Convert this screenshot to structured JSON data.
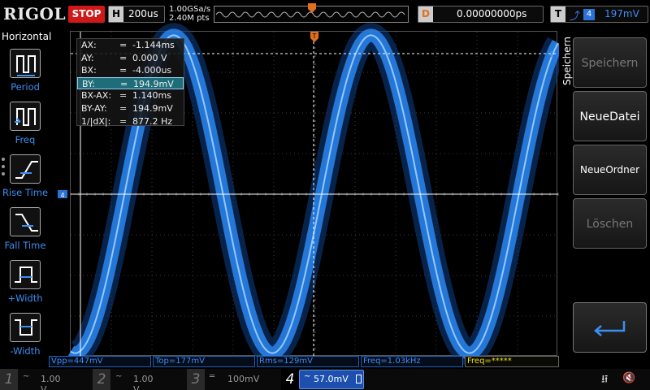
{
  "topbar": {
    "brand": "RIGOL",
    "run_state": "STOP",
    "horizontal": {
      "key": "H",
      "timebase": "200us"
    },
    "sample_rate": "1.00GSa/s",
    "memory_points": "2.40M pts",
    "delay": {
      "key": "D",
      "value": "0.00000000ps"
    },
    "trigger": {
      "key": "T",
      "edge_symbol": "⤴",
      "source": "4",
      "level": "197mV"
    }
  },
  "left_menu": {
    "title": "Horizontal",
    "items": [
      {
        "label": "Period",
        "icon": "period-icon"
      },
      {
        "label": "Freq",
        "icon": "frequency-icon"
      },
      {
        "label": "Rise Time",
        "icon": "rise-time-icon"
      },
      {
        "label": "Fall Time",
        "icon": "fall-time-icon"
      },
      {
        "label": "+Width",
        "icon": "positive-width-icon"
      },
      {
        "label": "-Width",
        "icon": "negative-width-icon"
      }
    ]
  },
  "cursor_readout": {
    "rows": [
      {
        "label": "AX:",
        "eq": "=",
        "value": "-1.144ms"
      },
      {
        "label": "AY:",
        "eq": "=",
        "value": "0.000 V"
      },
      {
        "label": "BX:",
        "eq": "=",
        "value": "-4.000us"
      },
      {
        "label": "BY:",
        "eq": "=",
        "value": "194.9mV"
      },
      {
        "label": "BX-AX:",
        "eq": "=",
        "value": "1.140ms"
      },
      {
        "label": "BY-AY:",
        "eq": "=",
        "value": "194.9mV"
      },
      {
        "label": "1/|dX|:",
        "eq": "=",
        "value": "877.2 Hz"
      }
    ],
    "selected_row": 3
  },
  "right_menu": {
    "title": "Speichern",
    "buttons": [
      {
        "label": "Speichern",
        "enabled": false
      },
      {
        "label": "NeueDatei",
        "enabled": true
      },
      {
        "label": "NeueOrdner",
        "enabled": true
      },
      {
        "label": "Löschen",
        "enabled": false
      }
    ],
    "back_icon": "return-arrow-icon"
  },
  "measurements": [
    {
      "text": "Vpp=447mV",
      "color": "#3f8df0"
    },
    {
      "text": "Top=177mV",
      "color": "#3f8df0"
    },
    {
      "text": "Rms=129mV",
      "color": "#3f8df0"
    },
    {
      "text": "Freq=1.03kHz",
      "color": "#3f8df0"
    },
    {
      "text": "Freq=*****",
      "color": "#e8e020"
    }
  ],
  "channels": [
    {
      "num": "1",
      "coupling": "~",
      "scale": "1.00 V",
      "active": false
    },
    {
      "num": "2",
      "coupling": "~",
      "scale": "1.00 V",
      "active": false
    },
    {
      "num": "3",
      "coupling": "═",
      "scale": "100mV",
      "active": false
    },
    {
      "num": "4",
      "coupling": "~",
      "scale": "57.0mV",
      "active": true
    }
  ],
  "status_icons": [
    "usb-icon",
    "speaker-muted-icon"
  ],
  "waveform": {
    "channel": "4",
    "color": "#2a86f0",
    "channel_marker": "4",
    "trigger_marker": "T",
    "frequency_hz": 1030,
    "amplitude_mv": 223,
    "timebase_us_per_div": 200,
    "volts_per_div_mv": 57
  }
}
